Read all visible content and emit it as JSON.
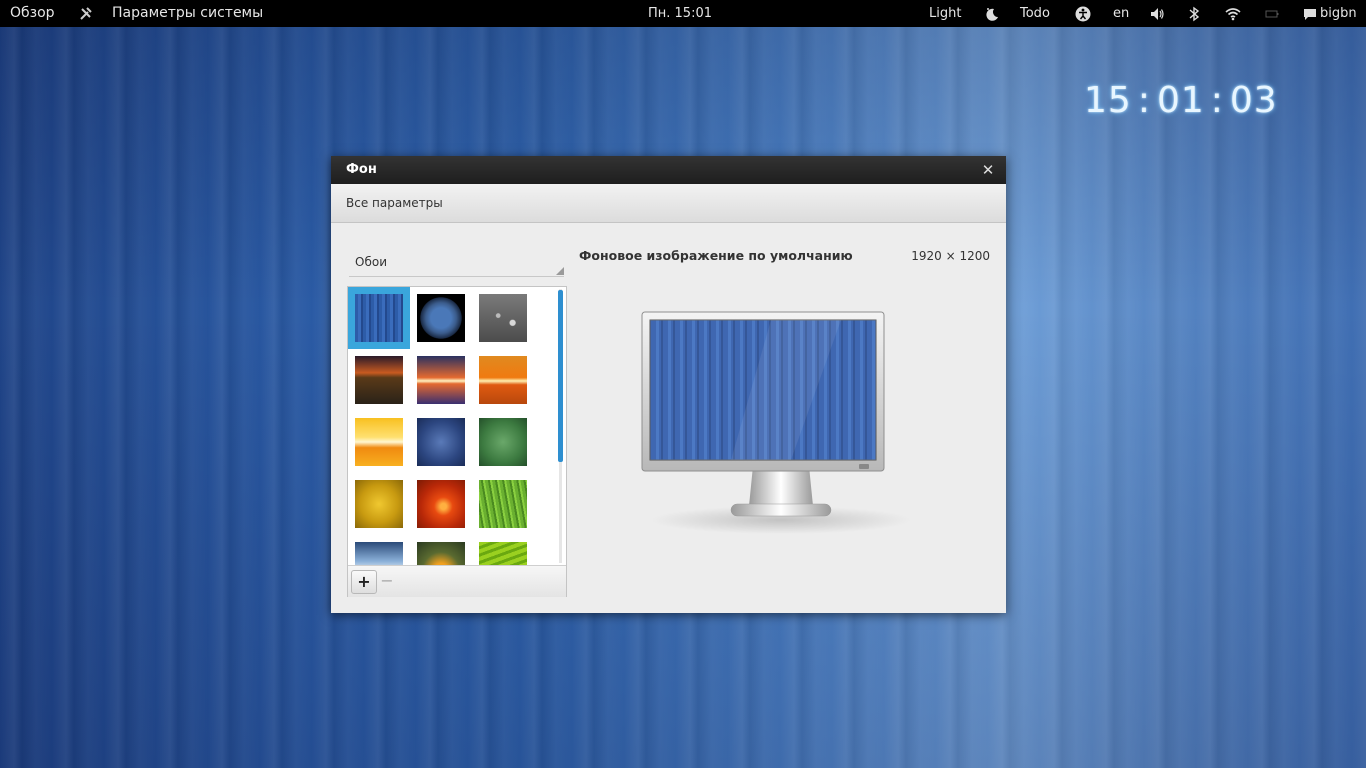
{
  "top_panel": {
    "overview": "Обзор",
    "app_name": "Параметры системы",
    "clock": "Пн. 15:01",
    "light": "Light",
    "todo": "Todo",
    "language": "en",
    "user": "bigbn"
  },
  "desktop_clock": {
    "hours": "15",
    "minutes": "01",
    "seconds": "03",
    "separator": ":"
  },
  "window": {
    "title": "Фон",
    "close_symbol": "✕",
    "all_settings": "Все параметры",
    "source_select": "Обои",
    "background_name": "Фоновое изображение по умолчанию",
    "background_size": "1920 × 1200",
    "add_symbol": "+",
    "remove_symbol": "−"
  },
  "wallpapers": [
    {
      "name": "blue-stripes",
      "selected": true
    },
    {
      "name": "earth",
      "selected": false
    },
    {
      "name": "droplets",
      "selected": false
    },
    {
      "name": "dusk-road",
      "selected": false
    },
    {
      "name": "light-flare-purple",
      "selected": false
    },
    {
      "name": "light-flare-orange",
      "selected": false
    },
    {
      "name": "yellow-flare",
      "selected": false
    },
    {
      "name": "blue-radial",
      "selected": false
    },
    {
      "name": "green-radial",
      "selected": false
    },
    {
      "name": "yellow-radial",
      "selected": false
    },
    {
      "name": "orange-flower",
      "selected": false
    },
    {
      "name": "green-grass",
      "selected": false
    },
    {
      "name": "sky",
      "selected": false
    },
    {
      "name": "flower-2",
      "selected": false
    },
    {
      "name": "green-leaf",
      "selected": false
    }
  ],
  "colors": {
    "selection_accent": "#3aa6dc",
    "scrollbar": "#2e8fd0",
    "panel_bg": "#000000",
    "window_bg": "#ededed"
  }
}
